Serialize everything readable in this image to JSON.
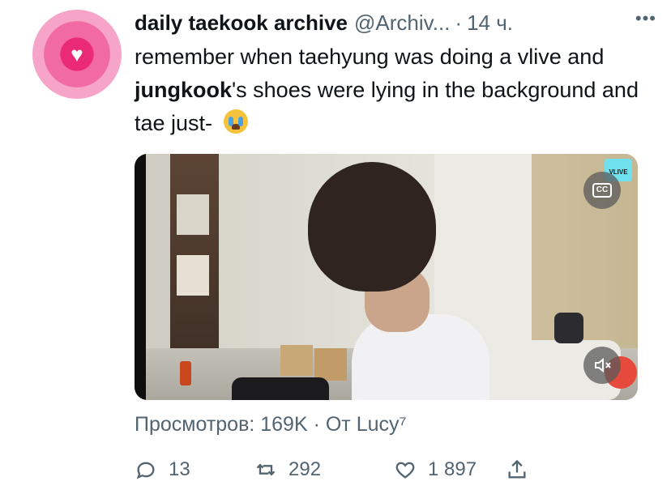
{
  "tweet": {
    "author_name": "daily taekook archive",
    "author_handle": "@Archiv...",
    "separator": "·",
    "time": "14 ч.",
    "more_label": "•••",
    "text_part1": "remember when taehyung was doing a vlive and ",
    "text_bold": "jungkook",
    "text_part2": "'s shoes were lying in the background and tae just-",
    "emoji": "loudly-crying-face"
  },
  "video": {
    "cc_label": "CC",
    "watermark": "VLIVE",
    "mute_icon": "speaker-muted-icon"
  },
  "meta": {
    "views_line": "Просмотров: 169K · От Lucy⁷"
  },
  "actions": {
    "reply_count": "13",
    "retweet_count": "292",
    "like_count": "1 897"
  },
  "colors": {
    "text_primary": "#0f1419",
    "text_secondary": "#536471",
    "avatar_pink": "#ea2a76"
  }
}
